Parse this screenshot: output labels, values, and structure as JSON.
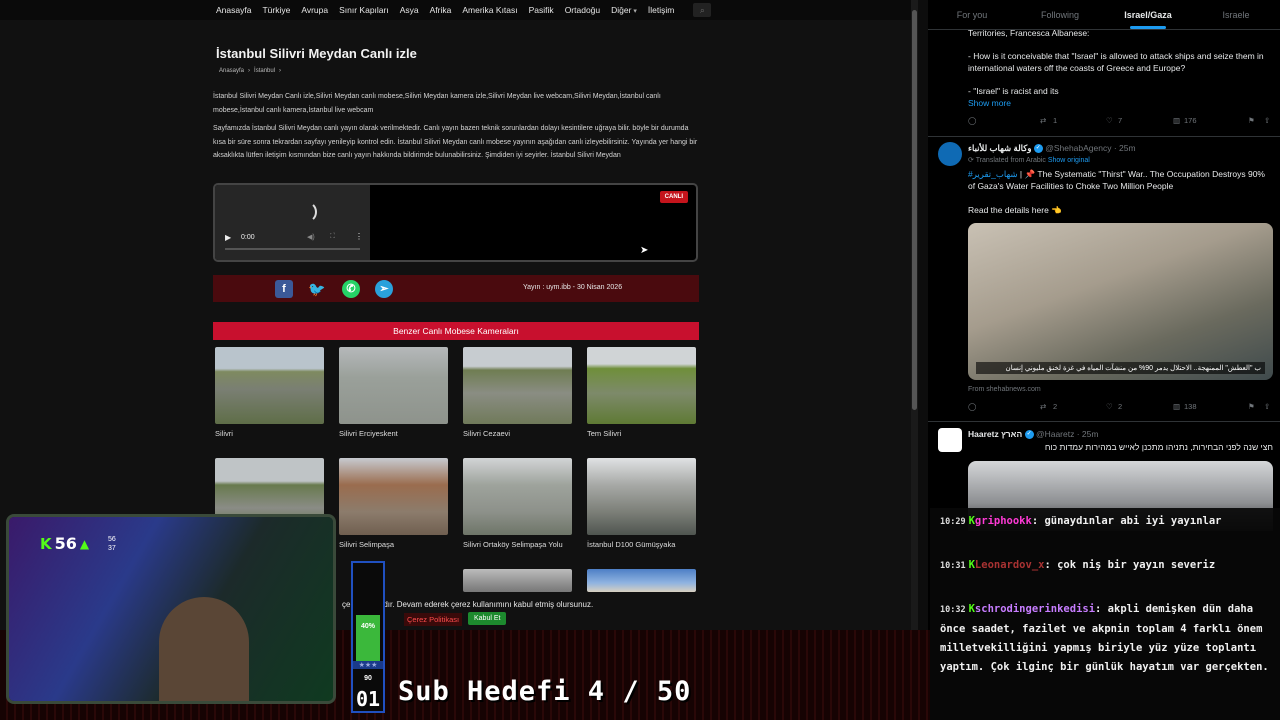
{
  "nav": {
    "items": [
      "Anasayfa",
      "Türkiye",
      "Avrupa",
      "Sınır Kapıları",
      "Asya",
      "Afrika",
      "Amerika Kıtası",
      "Pasifik",
      "Ortadoğu",
      "Diğer",
      "İletişim"
    ]
  },
  "page": {
    "title": "İstanbul Silivri Meydan Canlı izle",
    "breadcrumb": [
      "Anasayfa",
      "›",
      "İstanbul",
      "›"
    ],
    "para1": "İstanbul Silivri Meydan Canlı izle,Silivri Meydan canlı mobese,Silivri Meydan kamera izle,Silivri Meydan live webcam,Silivri Meydan,İstanbul canlı mobese,İstanbul canlı kamera,İstanbul live webcam",
    "para2": "Sayfamızda İstanbul Silivri Meydan canlı yayın olarak verilmektedir. Canlı yayın bazen teknik sorunlardan dolayı kesintilere uğraya bilir. böyle bir durumda kısa bir süre sonra tekrardan sayfayı yenileyip kontrol edin. İstanbul Silivri Meydan canlı mobese yayının aşağıdan canlı izleyebilirsiniz. Yayında yer hangi bir aksaklıkta lütfen iletişim kısmından bize canlı yayın hakkında bildirimde bulunabilirsiniz. Şimdiden iyi seyirler. İstanbul Silivri Meydan"
  },
  "video": {
    "time": "0:00",
    "live_badge": "CANLI"
  },
  "share": {
    "date": "Yayın : uym.ibb - 30 Nisan 2026"
  },
  "similar": {
    "heading": "Benzer Canlı Mobese Kameraları",
    "cams": [
      {
        "label": "Silivri"
      },
      {
        "label": "Silivri Erciyeskent"
      },
      {
        "label": "Silivri Cezaevi"
      },
      {
        "label": "Tem Silivri"
      },
      {
        "label": ""
      },
      {
        "label": "Silivri Selimpaşa"
      },
      {
        "label": "Silivri Ortaköy Selimpaşa Yolu"
      },
      {
        "label": "İstanbul D100 Gümüşyaka"
      }
    ]
  },
  "cookie": {
    "text": "çe                    anmaktadır. Devam ederek çerez kullanımını kabul etmiş olursunuz.",
    "policy": "Çerez Politikası",
    "accept": "Kabul Et"
  },
  "twitter": {
    "tabs": [
      "For you",
      "Following",
      "Israel/Gaza",
      "Israele"
    ],
    "active_tab": "Israel/Gaza",
    "tweet1": {
      "line0": "Territories, Francesca Albanese:",
      "line1": "- How is it conceivable that \"Israel\" is allowed to attack ships and seize them in international waters off the coasts of Greece and Europe?",
      "line2": "- \"Israel\" is racist and its",
      "show_more": "Show more",
      "replies": "",
      "reposts": "1",
      "likes": "7",
      "views": "176"
    },
    "tweet2": {
      "name": "وكالة شهاب للأنباء",
      "handle": "@ShehabAgency · 25m",
      "translated": "Translated from Arabic",
      "show_original": "Show original",
      "hashtag": "#شهاب_تقرير",
      "text": "| 📌 The Systematic \"Thirst\" War.. The Occupation Destroys 90% of Gaza's Water Facilities to Choke Two Million People",
      "details": "Read the details here 👈",
      "image_caption": "ب \"العطش\" الممنهجة.. الاحتلال يدمر 90% من منشآت المياه في غزة لخنق مليوني إنسان",
      "source": "From shehabnews.com",
      "replies": "",
      "reposts": "2",
      "likes": "2",
      "views": "138"
    },
    "tweet3": {
      "name": "Haaretz הארץ",
      "handle": "@Haaretz · 25m",
      "text": "חצי שנה לפני הבחירות, נתניהו מתכנן לאייש במהירות עמדות כוח"
    }
  },
  "chat": {
    "messages": [
      {
        "time": "10:29",
        "user": "griphookk",
        "user_color": "#ff3ad6",
        "text": ": günaydınlar abi iyi yayınlar"
      },
      {
        "time": "10:31",
        "user": "Leonardov_x",
        "user_color": "#a83232",
        "text": ": çok niş bir yayın severiz"
      },
      {
        "time": "10:32",
        "user": "schrodingerinkedisi",
        "user_color": "#c77dff",
        "text": ": akpli demişken dün daha önce saadet, fazilet ve akpnin toplam 4 farklı önem milletvekilliğini yapmış biriyle yüz yüze toplantı yaptım. Çok ilginç bir günlük hayatım var gerçekten."
      }
    ]
  },
  "overlay": {
    "kick_count": "56",
    "kick_sub_top": "56",
    "kick_sub_bottom": "37",
    "goal_percent": "40%",
    "goal_fraction": 0.4,
    "goal_stars": "★★★",
    "goal_num": "90",
    "goal_big": "01",
    "sub_goal": "Sub Hedefi 4 / 50"
  }
}
